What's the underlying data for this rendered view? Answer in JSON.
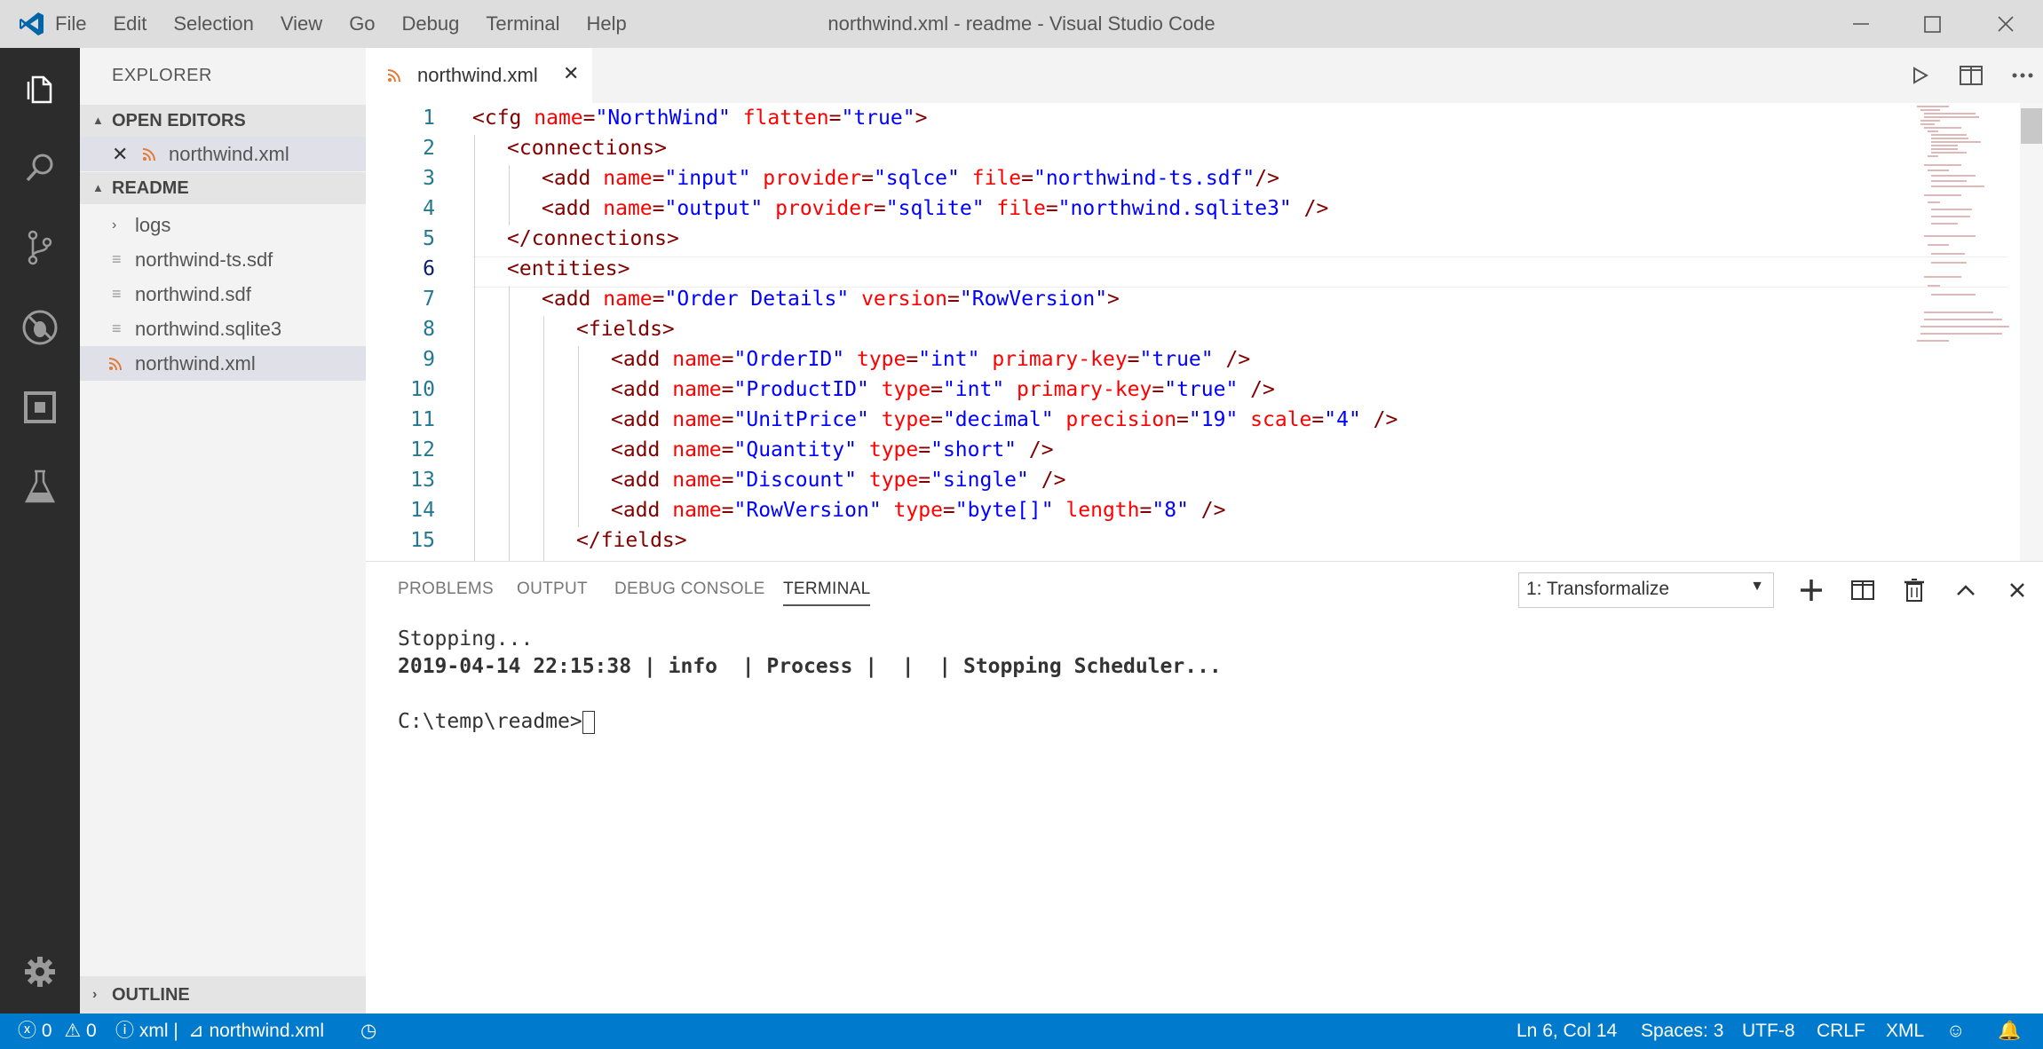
{
  "app": {
    "window_title": "northwind.xml - readme - Visual Studio Code",
    "menu": [
      "File",
      "Edit",
      "Selection",
      "View",
      "Go",
      "Debug",
      "Terminal",
      "Help"
    ]
  },
  "sidebar": {
    "title": "EXPLORER",
    "open_editors_label": "OPEN EDITORS",
    "open_editor_file": "northwind.xml",
    "folder_label": "README",
    "files": [
      {
        "name": "logs",
        "kind": "folder"
      },
      {
        "name": "northwind-ts.sdf",
        "kind": "file"
      },
      {
        "name": "northwind.sdf",
        "kind": "file"
      },
      {
        "name": "northwind.sqlite3",
        "kind": "file"
      },
      {
        "name": "northwind.xml",
        "kind": "xml",
        "selected": true
      }
    ],
    "outline_label": "OUTLINE"
  },
  "editor": {
    "tab_label": "northwind.xml",
    "line_numbers": [
      "1",
      "2",
      "3",
      "4",
      "5",
      "6",
      "7",
      "8",
      "9",
      "10",
      "11",
      "12",
      "13",
      "14",
      "15"
    ],
    "current_line": "6"
  },
  "panel": {
    "tabs": [
      "PROBLEMS",
      "OUTPUT",
      "DEBUG CONSOLE",
      "TERMINAL"
    ],
    "active_tab": "TERMINAL",
    "terminal_select": "1: Transformalize",
    "terminal_lines": [
      "Stopping...",
      "2019-04-14 22:15:38 | info  | Process |  |  | Stopping Scheduler...",
      "",
      "C:\\temp\\readme>"
    ]
  },
  "status": {
    "errors": "0",
    "warnings": "0",
    "lang_info": "xml",
    "file": "northwind.xml",
    "cursor": "Ln 6, Col 14",
    "spaces": "Spaces: 3",
    "encoding": "UTF-8",
    "eol": "CRLF",
    "language": "XML"
  },
  "colors": {
    "activity_bar": "#2c2c2c",
    "status_bar": "#007acc",
    "tag": "#800000",
    "attribute": "#ff0000",
    "value": "#0000ff"
  }
}
